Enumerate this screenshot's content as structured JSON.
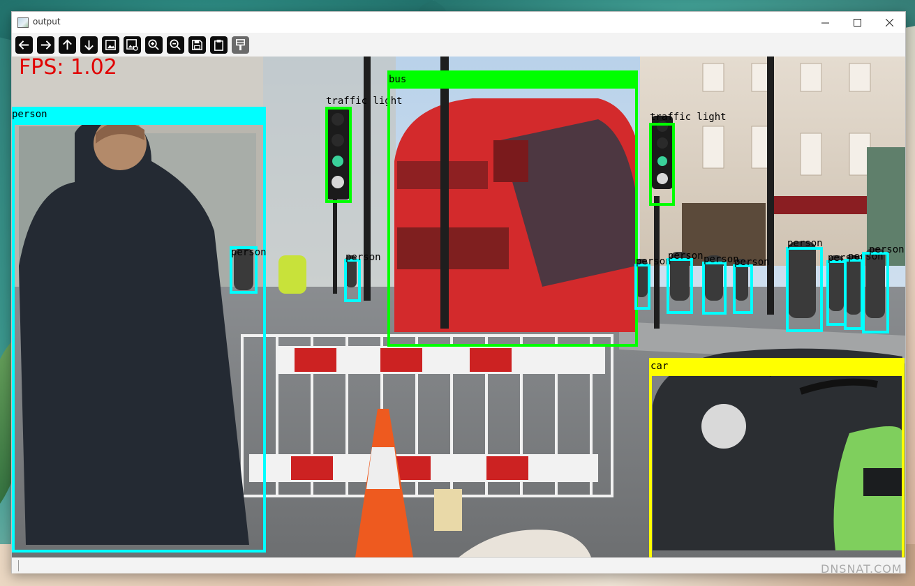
{
  "window": {
    "title": "output"
  },
  "titlebar_controls": {
    "minimize": "—",
    "maximize": "☐",
    "close": "✕"
  },
  "toolbar": {
    "buttons": [
      {
        "name": "pan-left",
        "icon": "arrow-left-icon"
      },
      {
        "name": "pan-right",
        "icon": "arrow-right-icon"
      },
      {
        "name": "pan-up",
        "icon": "arrow-up-icon"
      },
      {
        "name": "pan-down",
        "icon": "arrow-down-icon"
      },
      {
        "name": "zoom-fit",
        "icon": "image-icon"
      },
      {
        "name": "zoom-original",
        "icon": "image-detail-icon"
      },
      {
        "name": "zoom-in",
        "icon": "zoom-in-icon"
      },
      {
        "name": "zoom-out",
        "icon": "zoom-out-icon"
      },
      {
        "name": "save-image",
        "icon": "save-icon"
      },
      {
        "name": "copy-clipboard",
        "icon": "clipboard-icon"
      },
      {
        "name": "properties",
        "icon": "brush-icon"
      }
    ]
  },
  "overlay": {
    "fps_text": "FPS: 1.02",
    "fps_color": "#e10000"
  },
  "detections": [
    {
      "label": "person",
      "color": "#00ffff"
    },
    {
      "label": "traffic light",
      "color": "#00ff00"
    },
    {
      "label": "bus",
      "color": "#00ff00"
    },
    {
      "label": "traffic light",
      "color": "#00ff00"
    },
    {
      "label": "person",
      "color": "#00ffff"
    },
    {
      "label": "person",
      "color": "#00ffff"
    },
    {
      "label": "person",
      "color": "#00ffff"
    },
    {
      "label": "person",
      "color": "#00ffff"
    },
    {
      "label": "person",
      "color": "#00ffff"
    },
    {
      "label": "person",
      "color": "#00ffff"
    },
    {
      "label": "person",
      "color": "#00ffff"
    },
    {
      "label": "person",
      "color": "#00ffff"
    },
    {
      "label": "person",
      "color": "#00ffff"
    },
    {
      "label": "person",
      "color": "#00ffff"
    },
    {
      "label": "car",
      "color": "#ffff00"
    }
  ],
  "watermark": "DNSNAT.COM"
}
